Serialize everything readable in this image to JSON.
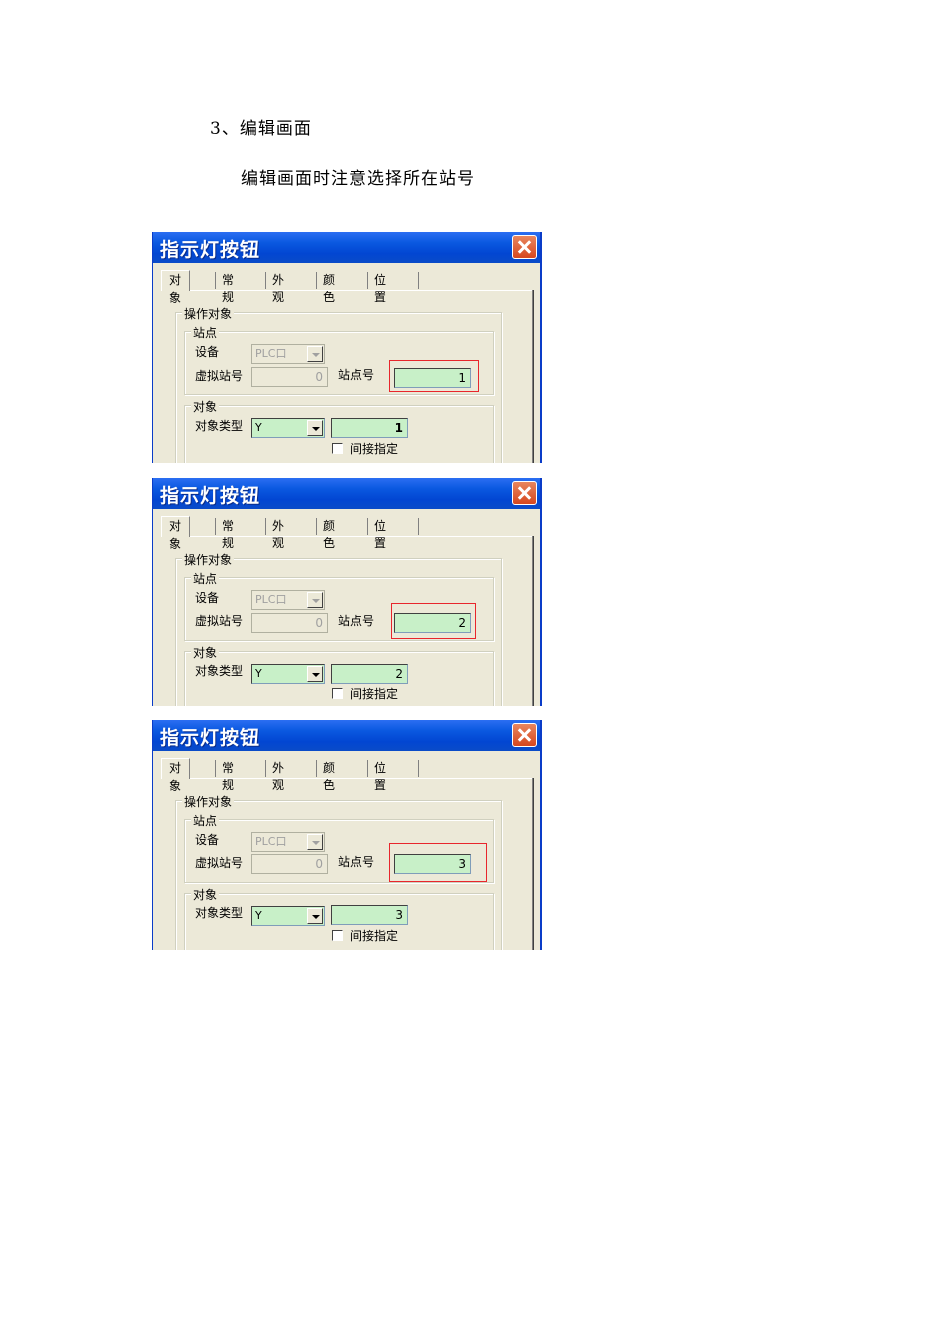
{
  "document": {
    "heading": "3、编辑画面",
    "subheading": "编辑画面时注意选择所在站号"
  },
  "dialogs": [
    {
      "title": "指示灯按钮",
      "tabs": [
        "对象",
        "常规",
        "外观",
        "颜色",
        "位置"
      ],
      "group_operation": "操作对象",
      "group_station": "站点",
      "device_label": "设备",
      "device_value": "PLC口",
      "virtual_station_label": "虚拟站号",
      "virtual_station_value": "0",
      "station_label": "站点号",
      "station_value": "1",
      "group_object": "对象",
      "object_type_label": "对象类型",
      "object_type_value": "Y",
      "object_address_value": "1",
      "indirect_label": "间接指定"
    },
    {
      "title": "指示灯按钮",
      "tabs": [
        "对象",
        "常规",
        "外观",
        "颜色",
        "位置"
      ],
      "group_operation": "操作对象",
      "group_station": "站点",
      "device_label": "设备",
      "device_value": "PLC口",
      "virtual_station_label": "虚拟站号",
      "virtual_station_value": "0",
      "station_label": "站点号",
      "station_value": "2",
      "group_object": "对象",
      "object_type_label": "对象类型",
      "object_type_value": "Y",
      "object_address_value": "2",
      "indirect_label": "间接指定"
    },
    {
      "title": "指示灯按钮",
      "tabs": [
        "对象",
        "常规",
        "外观",
        "颜色",
        "位置"
      ],
      "group_operation": "操作对象",
      "group_station": "站点",
      "device_label": "设备",
      "device_value": "PLC口",
      "virtual_station_label": "虚拟站号",
      "virtual_station_value": "0",
      "station_label": "站点号",
      "station_value": "3",
      "group_object": "对象",
      "object_type_label": "对象类型",
      "object_type_value": "Y",
      "object_address_value": "3",
      "indirect_label": "间接指定"
    }
  ],
  "colors": {
    "titlebar": "#0a58e0",
    "dialog_bg": "#ece9d8",
    "field_green": "#c8f0c8",
    "highlight_red": "#e8262c",
    "close_button": "#d6471f"
  }
}
